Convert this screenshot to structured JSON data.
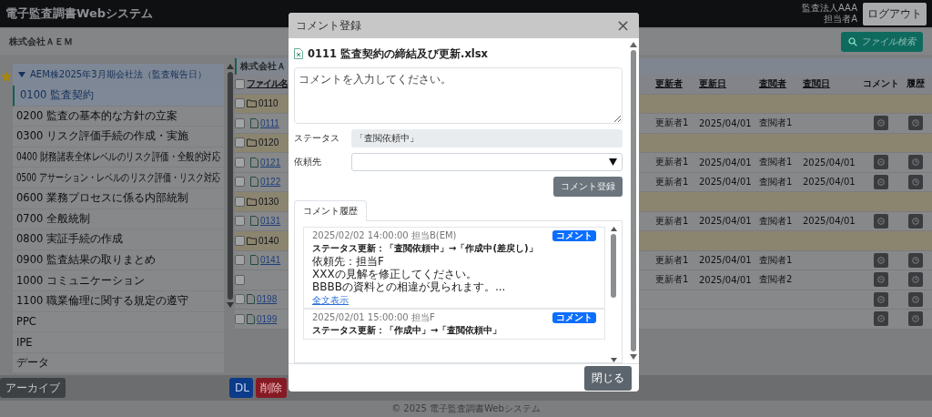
{
  "header": {
    "title": "電子監査調書Webシステム",
    "org": "監査法人AAA",
    "user": "担当者A",
    "logout": "ログアウト"
  },
  "company_bar": {
    "name": "株式会社ＡＥＭ",
    "search_button": "ファイル検索"
  },
  "sidebar": {
    "favorite": true,
    "group": {
      "label": "AEM株2025年3月期会社法（監査報告日）",
      "expanded": true
    },
    "items": [
      {
        "label": "0100 監査契約",
        "selected": true
      },
      {
        "label": "0200 監査の基本的な方針の立案",
        "selected": false
      },
      {
        "label": "0300 リスク評価手続の作成・実施",
        "selected": false
      },
      {
        "label": "0400 財務諸表全体レベルのリスク評価・全般的対応",
        "selected": false
      },
      {
        "label": "0500 アサーション・レベルのリスク評価・リスク対応",
        "selected": false
      },
      {
        "label": "0600 業務プロセスに係る内部統制",
        "selected": false
      },
      {
        "label": "0700 全般統制",
        "selected": false
      },
      {
        "label": "0800 実証手続の作成",
        "selected": false
      },
      {
        "label": "0900 監査結果の取りまとめ",
        "selected": false
      },
      {
        "label": "1000 コミュニケーション",
        "selected": false
      },
      {
        "label": "1100 職業倫理に関する規定の遵守",
        "selected": false
      },
      {
        "label": "PPC",
        "selected": false
      },
      {
        "label": "IPE",
        "selected": false
      },
      {
        "label": "データ",
        "selected": false
      }
    ]
  },
  "table": {
    "title": "株式会社Ａ",
    "all_checked": false,
    "columns": [
      "ファイル名",
      "更新者",
      "更新日",
      "査閲者",
      "査閲日",
      "コメント",
      "履歴"
    ],
    "rows": [
      {
        "kind": "folder",
        "name": "0110",
        "checked": false,
        "children": [
          {
            "kind": "file",
            "name": "0111",
            "checked": false,
            "cells": [
              "更新者1",
              "2025/04/01",
              "査閲者1"
            ]
          }
        ]
      },
      {
        "kind": "folder",
        "name": "0120",
        "checked": false,
        "children": [
          {
            "kind": "file",
            "name": "0121",
            "checked": false,
            "cells": [
              "更新者1",
              "2025/04/01",
              "査閲者1",
              "2025/04/01"
            ]
          },
          {
            "kind": "file",
            "name": "0122",
            "checked": false,
            "cells": [
              "更新者1",
              "2025/04/01",
              "査閲者1",
              "2025/04/01"
            ]
          }
        ]
      },
      {
        "kind": "folder",
        "name": "0130",
        "checked": false,
        "children": [
          {
            "kind": "file",
            "name": "0131",
            "checked": false,
            "cells": [
              "更新者1",
              "2025/04/01",
              "査閲者1",
              "2025/04/01"
            ]
          }
        ]
      },
      {
        "kind": "folder",
        "name": "0140",
        "checked": false,
        "children": [
          {
            "kind": "file",
            "name": "0141",
            "checked": false,
            "cells": [
              "更新者1",
              "2025/04/01",
              "査閲者1"
            ]
          },
          {
            "kind": "file",
            "checked": false,
            "cells": [
              "更新者1",
              "2025/04/01",
              "査閲者2"
            ]
          }
        ]
      },
      {
        "kind": "file",
        "name": "0198",
        "checked": false
      },
      {
        "kind": "file",
        "name": "0199",
        "checked": false
      }
    ]
  },
  "bottom_bar": {
    "archive": "アーカイブ",
    "download": "DL",
    "delete": "削除"
  },
  "footer": "© 2025 電子監査調書Webシステム",
  "modal": {
    "title": "コメント登録",
    "close": "×",
    "file": "0111 監査契約の締結及び更新.xlsx",
    "comment": {
      "placeholder": "コメントを入力してください。"
    },
    "status": {
      "label": "ステータス",
      "value": "「査閲依頼中」"
    },
    "assignee": {
      "label": "依頼先"
    },
    "submit": "コメント登録",
    "tabs": [
      {
        "label": "コメント履歴",
        "selected": true
      }
    ],
    "history": [
      {
        "meta": "2025/02/02 14:00:00 担当B(EM)",
        "badge": "コメント",
        "title": "ステータス更新：「査閲依頼中」→「作成中(差戻し)」",
        "lines": [
          "依頼先：担当F",
          "XXXの見解を修正してください。",
          "BBBBの資料との相違が見られます。..."
        ],
        "link": "全文表示"
      },
      {
        "meta": "2025/02/01 15:00:00 担当F",
        "badge": "コメント",
        "title": "ステータス更新：「作成中」→「査閲依頼中」"
      }
    ],
    "close_button": "閉じる"
  }
}
